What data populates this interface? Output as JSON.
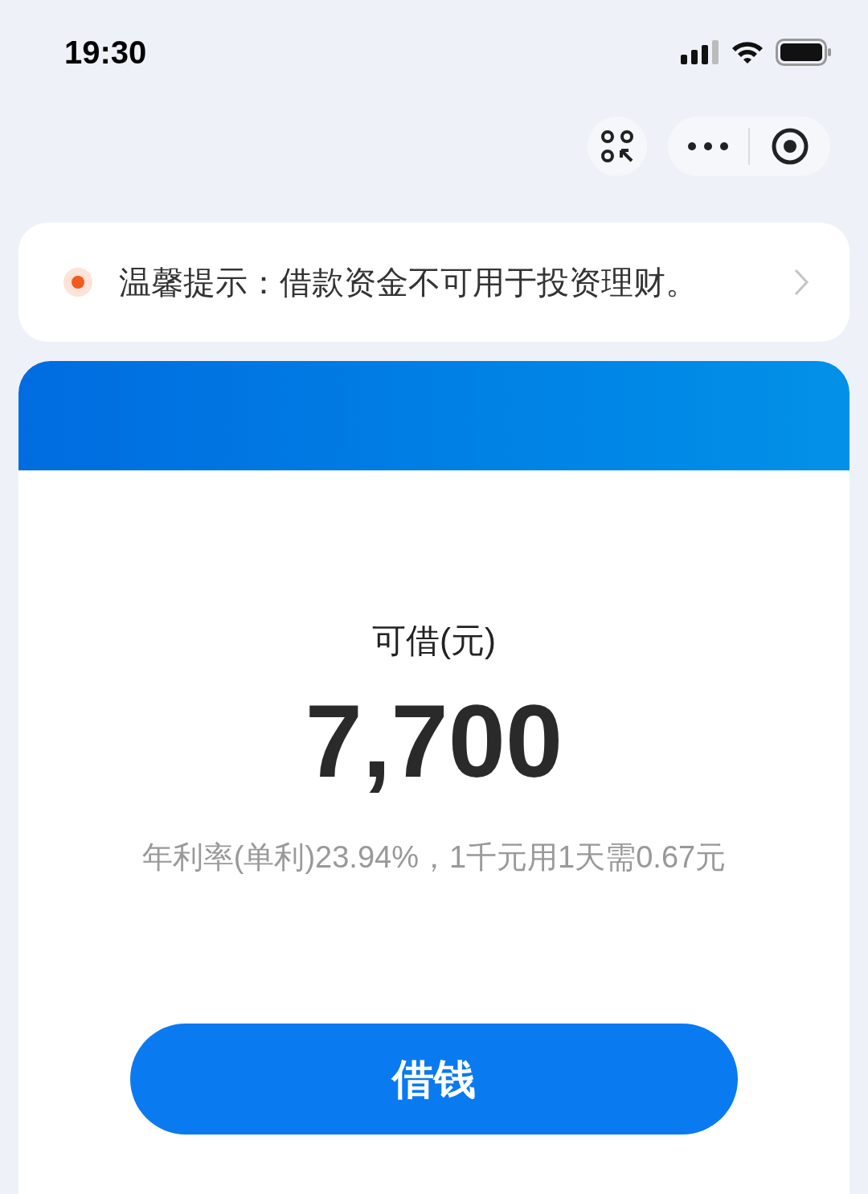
{
  "status_bar": {
    "time": "19:30"
  },
  "notice": {
    "label": "温馨提示：",
    "text": "借款资金不可用于投资理财。"
  },
  "loan": {
    "title": "可借(元)",
    "amount": "7,700",
    "rate_note": "年利率(单利)23.94%，1千元用1天需0.67元",
    "button": "借钱"
  }
}
